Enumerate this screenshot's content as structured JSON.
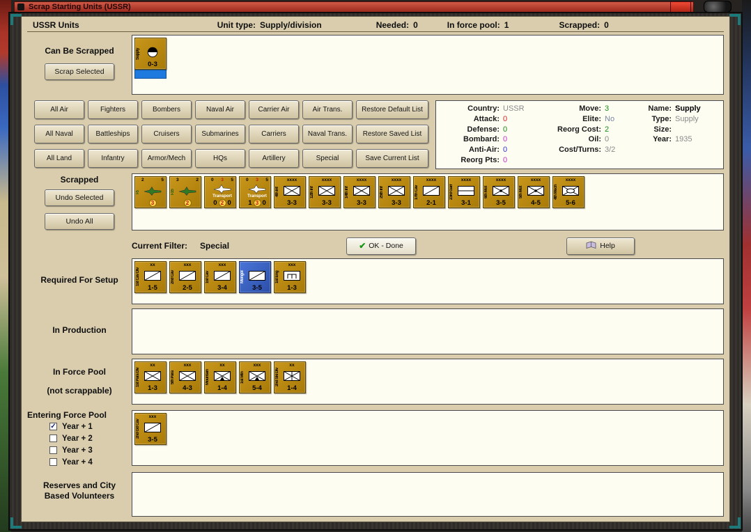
{
  "colors": {
    "counter_gold": "#b8860b",
    "counter_blue": "#3c63c8",
    "selection_blue": "#1f7ae0",
    "titlebar_red": "#a93226",
    "badge_yellow": "#ffd24a",
    "badge_text_red": "#c01818",
    "stat": {
      "red": "#d42222",
      "green": "#1a8a1a",
      "magenta": "#c333c3",
      "blue": "#3333cc",
      "gray": "#8a8a8a",
      "grayblue": "#7a86a0",
      "black": "#000000"
    }
  },
  "icons": {
    "check": "✓",
    "ok_check": "✔"
  },
  "window": {
    "title": "Scrap Starting Units (USSR)"
  },
  "header": {
    "left": "USSR Units",
    "unit_type_label": "Unit type:",
    "unit_type_value": "Supply/division",
    "needed_label": "Needed:",
    "needed_value": "0",
    "force_pool_label": "In force pool:",
    "force_pool_value": "1",
    "scrapped_label": "Scrapped:",
    "scrapped_value": "0"
  },
  "can_be_scrapped": {
    "label": "Can Be Scrapped",
    "button": "Scrap Selected",
    "units": [
      {
        "side": "Supply",
        "bottom": "0-3",
        "symbol": "supply",
        "selected": true
      }
    ]
  },
  "filters": {
    "rows": [
      [
        "All Air",
        "Fighters",
        "Bombers",
        "Naval Air",
        "Carrier Air",
        "Air Trans.",
        "Restore Default List"
      ],
      [
        "All Naval",
        "Battleships",
        "Cruisers",
        "Submarines",
        "Carriers",
        "Naval Trans.",
        "Restore Saved List"
      ],
      [
        "All Land",
        "Infantry",
        "Armor/Mech",
        "HQs",
        "Artillery",
        "Special",
        "Save Current List"
      ]
    ]
  },
  "info": {
    "col1": [
      {
        "label": "Country:",
        "value": "USSR",
        "color": "gray"
      },
      {
        "label": "Attack:",
        "value": "0",
        "color": "red"
      },
      {
        "label": "Defense:",
        "value": "0",
        "color": "green"
      },
      {
        "label": "Bombard:",
        "value": "0",
        "color": "magenta"
      },
      {
        "label": "Anti-Air:",
        "value": "0",
        "color": "blue"
      },
      {
        "label": "Reorg Pts:",
        "value": "0",
        "color": "magenta"
      }
    ],
    "col2": [
      {
        "label": "Move:",
        "value": "3",
        "color": "green"
      },
      {
        "label": "Elite:",
        "value": "No",
        "color": "grayblue"
      },
      {
        "label": "Reorg Cost:",
        "value": "2",
        "color": "green"
      },
      {
        "label": "Oil:",
        "value": "0",
        "color": "gray"
      },
      {
        "label": "Cost/Turns:",
        "value": "3/2",
        "color": "gray"
      }
    ],
    "col3": [
      {
        "label": "Name:",
        "value": "Supply",
        "color": "black",
        "bold": true
      },
      {
        "label": "Type:",
        "value": "Supply",
        "color": "gray"
      },
      {
        "label": "Size:",
        "value": "",
        "color": "gray"
      },
      {
        "label": "Year:",
        "value": "1935",
        "color": "gray"
      }
    ]
  },
  "scrapped": {
    "label": "Scrapped",
    "undo_selected": "Undo Selected",
    "undo_all": "Undo All",
    "units": [
      {
        "side": "I-5",
        "sideColor": "green",
        "topLeft": "2",
        "topRight": "5",
        "badge": "3",
        "symbol": "fighter"
      },
      {
        "side": "I-15",
        "sideColor": "green",
        "topLeft": "3",
        "topRight": "2",
        "badge": "2",
        "symbol": "fighter"
      },
      {
        "topLeft": "0",
        "topMid": "3",
        "topRight": "5",
        "label": "Transport",
        "bottomLeft": "0",
        "badge": "2",
        "bottomRight": "0",
        "symbol": "transport"
      },
      {
        "topLeft": "0",
        "topMid": "3",
        "topRight": "5",
        "label": "Transport",
        "bottomLeft": "1",
        "badge": "3",
        "bottomRight": "0",
        "symbol": "transport"
      },
      {
        "side": "4th Inf",
        "top": "xxxx",
        "bottom": "3-3",
        "symbol": "inf"
      },
      {
        "side": "12th Inf",
        "top": "xxxx",
        "bottom": "3-3",
        "symbol": "inf"
      },
      {
        "side": "14th Inf",
        "top": "xxxx",
        "bottom": "3-3",
        "symbol": "inf"
      },
      {
        "side": "25th Inf",
        "top": "xxxx",
        "bottom": "3-3",
        "symbol": "inf"
      },
      {
        "side": "17th Cav",
        "top": "xxxx",
        "bottom": "2-1",
        "symbol": "cav"
      },
      {
        "side": "23rd Garr",
        "top": "xxxx",
        "bottom": "3-1",
        "symbol": "garr"
      },
      {
        "side": "6th Mot",
        "top": "xxxx",
        "bottom": "3-5",
        "symbol": "mot"
      },
      {
        "side": "5th Mot",
        "top": "xxxx",
        "bottom": "4-5",
        "symbol": "mot"
      },
      {
        "side": "4th Mech",
        "top": "xxxx",
        "bottom": "5-6",
        "symbol": "mech"
      }
    ]
  },
  "status": {
    "label": "Current Filter:",
    "value": "Special",
    "ok": "OK - Done",
    "help": "Help"
  },
  "required_for_setup": {
    "label": "Required For Setup",
    "units": [
      {
        "side": "1st Cav Div",
        "top": "xx",
        "bottom": "1-5",
        "symbol": "cav"
      },
      {
        "side": "2nd Cav",
        "top": "xxx",
        "bottom": "2-5",
        "symbol": "cav"
      },
      {
        "side": "1st Cav",
        "top": "xxx",
        "bottom": "3-4",
        "symbol": "cav"
      },
      {
        "side": "Mongol",
        "top": "",
        "bottom": "3-5",
        "symbol": "cav",
        "color": "blue"
      },
      {
        "side": "1st Eng",
        "top": "xxx",
        "bottom": "1-3",
        "symbol": "eng"
      }
    ]
  },
  "in_production": {
    "label": "In Production",
    "units": []
  },
  "in_force_pool": {
    "label1": "In Force Pool",
    "label2": "(not scrappable)",
    "units": [
      {
        "side": "1st Para Div",
        "top": "xx",
        "bottom": "1-3",
        "symbol": "inf"
      },
      {
        "side": "5th Para",
        "top": "xxx",
        "bottom": "4-3",
        "symbol": "inf"
      },
      {
        "side": "Mountain",
        "top": "xx",
        "bottom": "1-4",
        "symbol": "mtn"
      },
      {
        "side": "1st Mtn",
        "top": "xxx",
        "bottom": "5-4",
        "symbol": "mtn"
      },
      {
        "side": "2nd Ski Div",
        "top": "xx",
        "bottom": "1-4",
        "symbol": "ski"
      }
    ]
  },
  "entering_force_pool": {
    "label": "Entering Force Pool",
    "options": [
      {
        "label": "Year + 1",
        "checked": true
      },
      {
        "label": "Year + 2",
        "checked": false
      },
      {
        "label": "Year + 3",
        "checked": false
      },
      {
        "label": "Year + 4",
        "checked": false
      }
    ],
    "units": [
      {
        "side": "2nd Gd Cav",
        "top": "xxx",
        "bottom": "3-5",
        "symbol": "cav"
      }
    ]
  },
  "reserves": {
    "label": "Reserves and City Based Volunteers",
    "units": []
  }
}
